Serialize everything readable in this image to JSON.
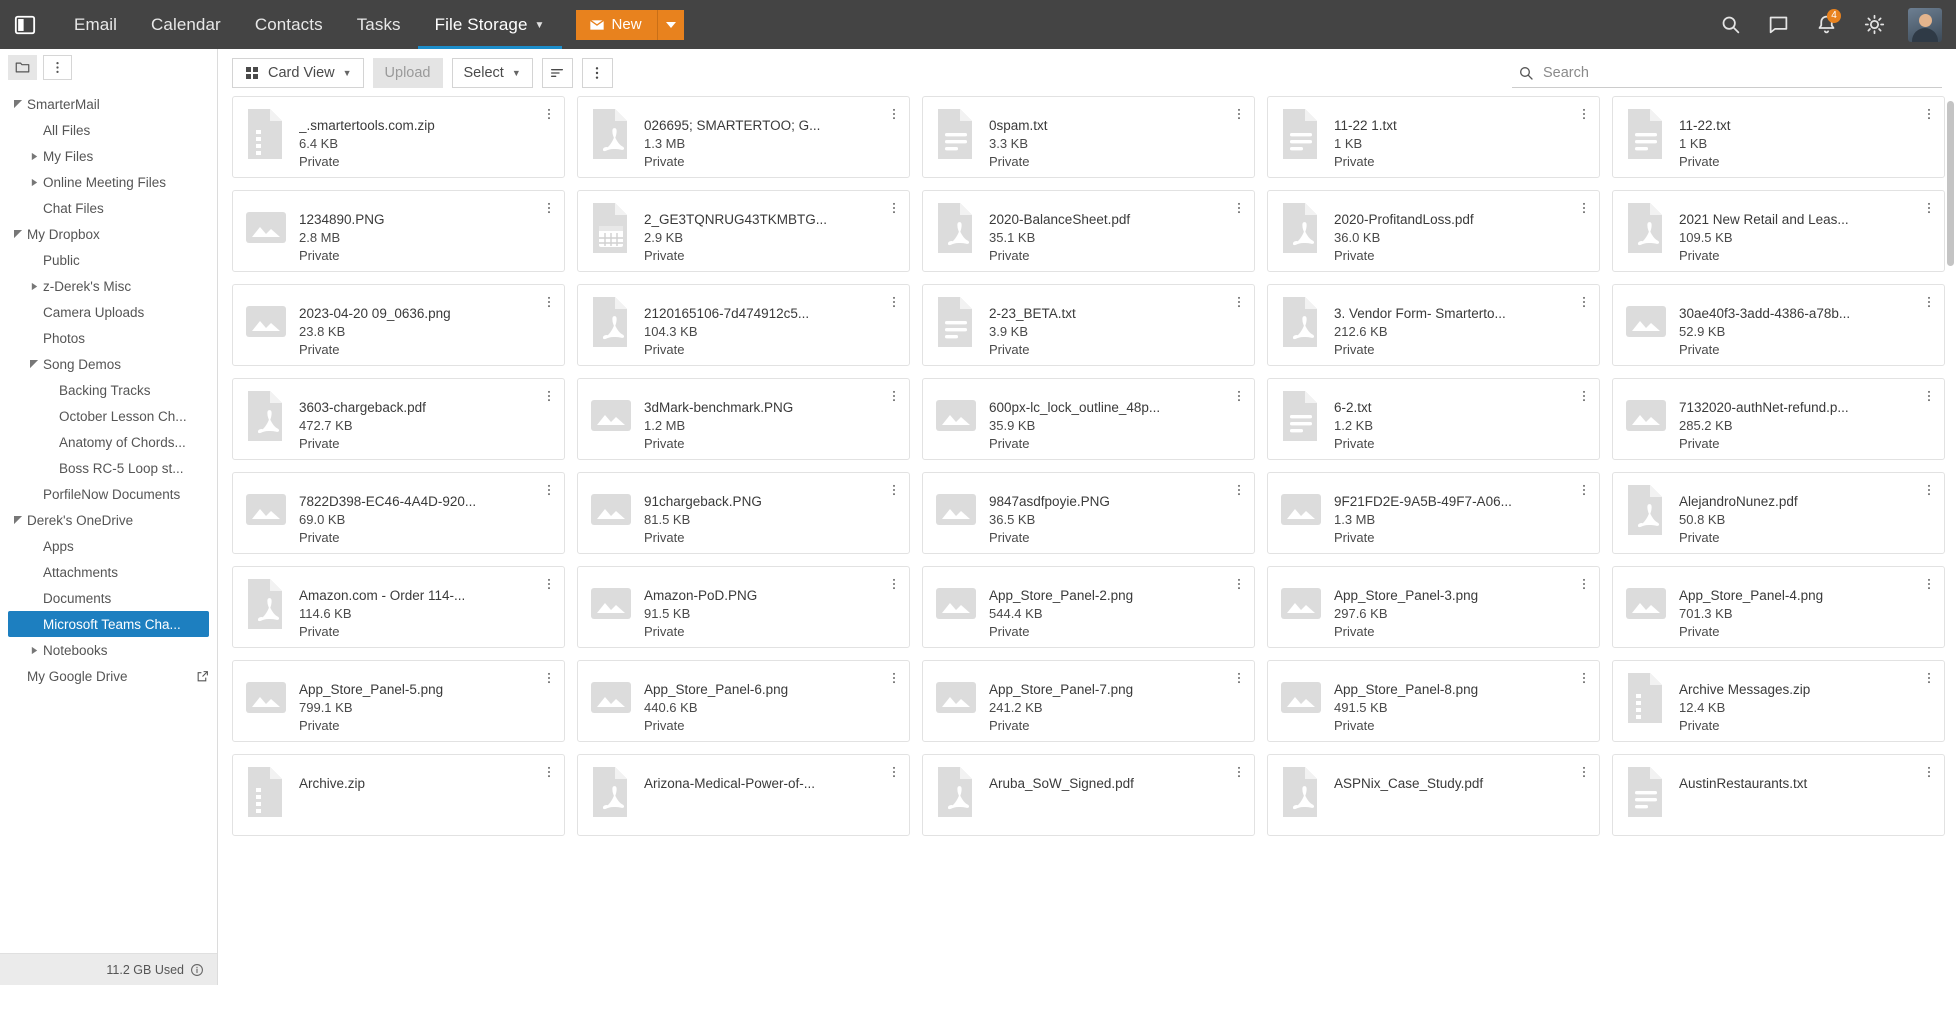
{
  "topbar": {
    "panel_toggle_icon": "panel-toggle-icon",
    "nav": [
      {
        "label": "Email",
        "active": false
      },
      {
        "label": "Calendar",
        "active": false
      },
      {
        "label": "Contacts",
        "active": false
      },
      {
        "label": "Tasks",
        "active": false
      },
      {
        "label": "File Storage",
        "active": true,
        "has_caret": true
      }
    ],
    "new_button": {
      "label": "New",
      "icon": "envelope-icon",
      "split_icon": "chevron-down-icon"
    },
    "right_icons": [
      {
        "name": "search-icon"
      },
      {
        "name": "chat-icon"
      },
      {
        "name": "bell-icon",
        "badge": "4"
      },
      {
        "name": "brightness-icon"
      }
    ],
    "avatar": "user-avatar"
  },
  "sidebar": {
    "header": {
      "folder_icon": "folder-icon",
      "more_icon": "more-vertical-icon"
    },
    "tree": [
      {
        "label": "SmarterMail",
        "indent": 0,
        "twisty": "expanded",
        "selected": false
      },
      {
        "label": "All Files",
        "indent": 1,
        "twisty": "none",
        "selected": false
      },
      {
        "label": "My Files",
        "indent": 1,
        "twisty": "collapsed",
        "selected": false
      },
      {
        "label": "Online Meeting Files",
        "indent": 1,
        "twisty": "collapsed",
        "selected": false
      },
      {
        "label": "Chat Files",
        "indent": 1,
        "twisty": "none",
        "selected": false
      },
      {
        "label": "My Dropbox",
        "indent": 0,
        "twisty": "expanded",
        "selected": false
      },
      {
        "label": "Public",
        "indent": 1,
        "twisty": "none",
        "selected": false
      },
      {
        "label": "z-Derek's Misc",
        "indent": 1,
        "twisty": "collapsed",
        "selected": false
      },
      {
        "label": "Camera Uploads",
        "indent": 1,
        "twisty": "none",
        "selected": false
      },
      {
        "label": "Photos",
        "indent": 1,
        "twisty": "none",
        "selected": false
      },
      {
        "label": "Song Demos",
        "indent": 1,
        "twisty": "expanded",
        "selected": false
      },
      {
        "label": "Backing Tracks",
        "indent": 2,
        "twisty": "none",
        "selected": false
      },
      {
        "label": "October Lesson Ch...",
        "indent": 2,
        "twisty": "none",
        "selected": false
      },
      {
        "label": "Anatomy of Chords...",
        "indent": 2,
        "twisty": "none",
        "selected": false
      },
      {
        "label": "Boss RC-5 Loop st...",
        "indent": 2,
        "twisty": "none",
        "selected": false
      },
      {
        "label": "PorfileNow Documents",
        "indent": 1,
        "twisty": "none",
        "selected": false
      },
      {
        "label": "Derek's OneDrive",
        "indent": 0,
        "twisty": "expanded",
        "selected": false
      },
      {
        "label": "Apps",
        "indent": 1,
        "twisty": "none",
        "selected": false
      },
      {
        "label": "Attachments",
        "indent": 1,
        "twisty": "none",
        "selected": false
      },
      {
        "label": "Documents",
        "indent": 1,
        "twisty": "none",
        "selected": false
      },
      {
        "label": "Microsoft Teams Cha...",
        "indent": 1,
        "twisty": "none",
        "selected": true
      },
      {
        "label": "Notebooks",
        "indent": 1,
        "twisty": "collapsed",
        "selected": false
      },
      {
        "label": "My Google Drive",
        "indent": 0,
        "twisty": "none",
        "selected": false,
        "external": true
      }
    ],
    "footer": {
      "storage_used": "11.2 GB Used",
      "info_icon": "info-icon"
    }
  },
  "toolbar": {
    "view_button": {
      "label": "Card View",
      "icon": "grid-icon",
      "caret": true
    },
    "upload_button": {
      "label": "Upload",
      "disabled": true
    },
    "select_button": {
      "label": "Select",
      "caret": true
    },
    "sort_button": {
      "icon": "sort-icon"
    },
    "more_button": {
      "icon": "more-vertical-icon"
    },
    "search": {
      "placeholder": "Search",
      "value": "",
      "icon": "search-icon"
    }
  },
  "files": [
    {
      "name": "_.smartertools.com.zip",
      "size": "6.4 KB",
      "permission": "Private",
      "type": "zip"
    },
    {
      "name": "026695; SMARTERTOO; G...",
      "size": "1.3 MB",
      "permission": "Private",
      "type": "pdf"
    },
    {
      "name": "0spam.txt",
      "size": "3.3 KB",
      "permission": "Private",
      "type": "txt"
    },
    {
      "name": "11-22 1.txt",
      "size": "1 KB",
      "permission": "Private",
      "type": "txt"
    },
    {
      "name": "11-22.txt",
      "size": "1 KB",
      "permission": "Private",
      "type": "txt"
    },
    {
      "name": "1234890.PNG",
      "size": "2.8 MB",
      "permission": "Private",
      "type": "image"
    },
    {
      "name": "2_GE3TQNRUG43TKMBTG...",
      "size": "2.9 KB",
      "permission": "Private",
      "type": "calendar"
    },
    {
      "name": "2020-BalanceSheet.pdf",
      "size": "35.1 KB",
      "permission": "Private",
      "type": "pdf"
    },
    {
      "name": "2020-ProfitandLoss.pdf",
      "size": "36.0 KB",
      "permission": "Private",
      "type": "pdf"
    },
    {
      "name": "2021 New Retail and Leas...",
      "size": "109.5 KB",
      "permission": "Private",
      "type": "pdf"
    },
    {
      "name": "2023-04-20 09_0636.png",
      "size": "23.8 KB",
      "permission": "Private",
      "type": "image"
    },
    {
      "name": "2120165106-7d474912c5...",
      "size": "104.3 KB",
      "permission": "Private",
      "type": "pdf"
    },
    {
      "name": "2-23_BETA.txt",
      "size": "3.9 KB",
      "permission": "Private",
      "type": "txt"
    },
    {
      "name": "3. Vendor Form- Smarterto...",
      "size": "212.6 KB",
      "permission": "Private",
      "type": "pdf"
    },
    {
      "name": "30ae40f3-3add-4386-a78b...",
      "size": "52.9 KB",
      "permission": "Private",
      "type": "image"
    },
    {
      "name": "3603-chargeback.pdf",
      "size": "472.7 KB",
      "permission": "Private",
      "type": "pdf"
    },
    {
      "name": "3dMark-benchmark.PNG",
      "size": "1.2 MB",
      "permission": "Private",
      "type": "image"
    },
    {
      "name": "600px-lc_lock_outline_48p...",
      "size": "35.9 KB",
      "permission": "Private",
      "type": "image"
    },
    {
      "name": "6-2.txt",
      "size": "1.2 KB",
      "permission": "Private",
      "type": "txt"
    },
    {
      "name": "7132020-authNet-refund.p...",
      "size": "285.2 KB",
      "permission": "Private",
      "type": "image"
    },
    {
      "name": "7822D398-EC46-4A4D-920...",
      "size": "69.0 KB",
      "permission": "Private",
      "type": "image"
    },
    {
      "name": "91chargeback.PNG",
      "size": "81.5 KB",
      "permission": "Private",
      "type": "image"
    },
    {
      "name": "9847asdfpoyie.PNG",
      "size": "36.5 KB",
      "permission": "Private",
      "type": "image"
    },
    {
      "name": "9F21FD2E-9A5B-49F7-A06...",
      "size": "1.3 MB",
      "permission": "Private",
      "type": "image"
    },
    {
      "name": "AlejandroNunez.pdf",
      "size": "50.8 KB",
      "permission": "Private",
      "type": "pdf"
    },
    {
      "name": "Amazon.com - Order 114-...",
      "size": "114.6 KB",
      "permission": "Private",
      "type": "pdf"
    },
    {
      "name": "Amazon-PoD.PNG",
      "size": "91.5 KB",
      "permission": "Private",
      "type": "image"
    },
    {
      "name": "App_Store_Panel-2.png",
      "size": "544.4 KB",
      "permission": "Private",
      "type": "image"
    },
    {
      "name": "App_Store_Panel-3.png",
      "size": "297.6 KB",
      "permission": "Private",
      "type": "image"
    },
    {
      "name": "App_Store_Panel-4.png",
      "size": "701.3 KB",
      "permission": "Private",
      "type": "image"
    },
    {
      "name": "App_Store_Panel-5.png",
      "size": "799.1 KB",
      "permission": "Private",
      "type": "image"
    },
    {
      "name": "App_Store_Panel-6.png",
      "size": "440.6 KB",
      "permission": "Private",
      "type": "image"
    },
    {
      "name": "App_Store_Panel-7.png",
      "size": "241.2 KB",
      "permission": "Private",
      "type": "image"
    },
    {
      "name": "App_Store_Panel-8.png",
      "size": "491.5 KB",
      "permission": "Private",
      "type": "image"
    },
    {
      "name": "Archive Messages.zip",
      "size": "12.4 KB",
      "permission": "Private",
      "type": "zip"
    },
    {
      "name": "Archive.zip",
      "size": "",
      "permission": "",
      "type": "zip"
    },
    {
      "name": "Arizona-Medical-Power-of-...",
      "size": "",
      "permission": "",
      "type": "pdf"
    },
    {
      "name": "Aruba_SoW_Signed.pdf",
      "size": "",
      "permission": "",
      "type": "pdf"
    },
    {
      "name": "ASPNix_Case_Study.pdf",
      "size": "",
      "permission": "",
      "type": "pdf"
    },
    {
      "name": "AustinRestaurants.txt",
      "size": "",
      "permission": "",
      "type": "txt"
    }
  ],
  "colors": {
    "topbar_bg": "#444444",
    "accent_orange": "#e8821e",
    "accent_blue": "#1d7fc0",
    "selected_item": "#1d7fc0"
  }
}
